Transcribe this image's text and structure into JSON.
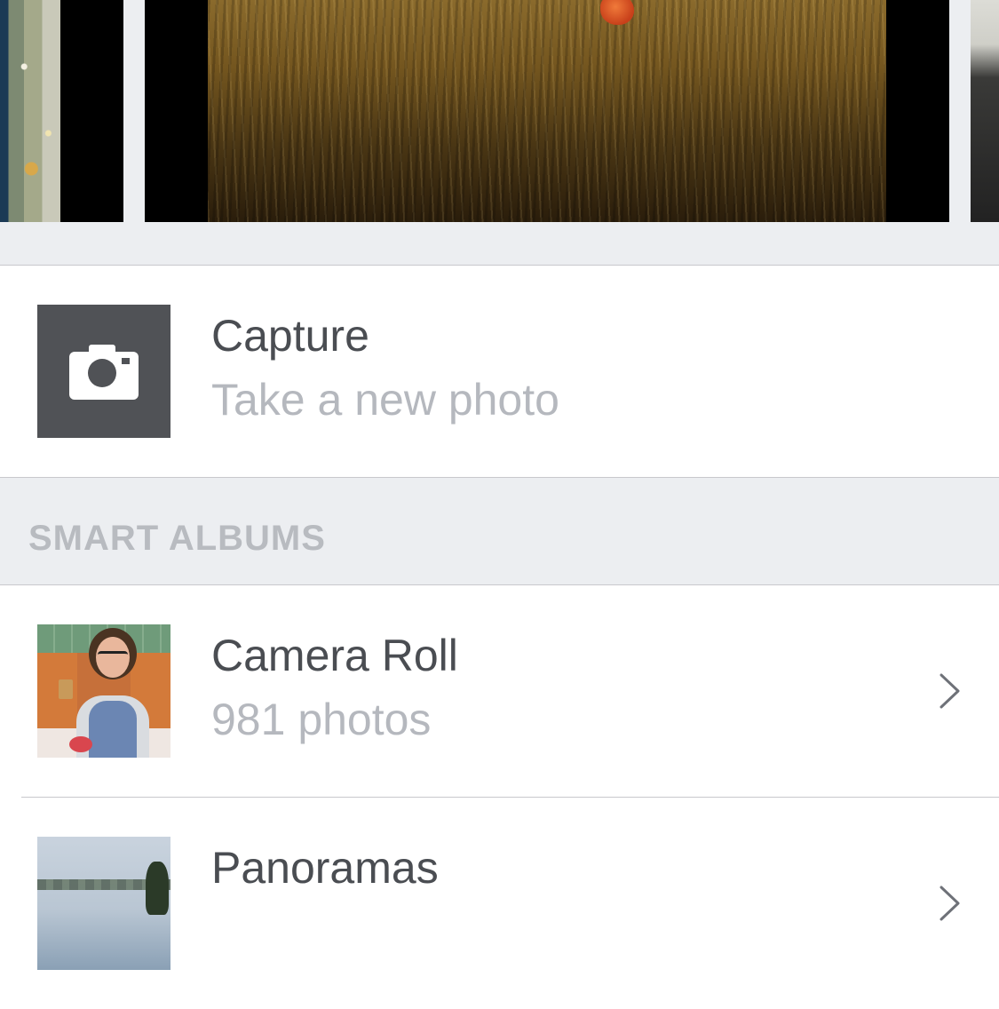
{
  "capture": {
    "title": "Capture",
    "subtitle": "Take a new photo",
    "icon": "camera-icon"
  },
  "smart_albums": {
    "header": "SMART ALBUMS",
    "items": [
      {
        "title": "Camera Roll",
        "subtitle": "981 photos",
        "icon": "chevron-right-icon"
      },
      {
        "title": "Panoramas",
        "icon": "chevron-right-icon"
      }
    ]
  },
  "colors": {
    "background": "#ffffff",
    "section_bg": "#eceef1",
    "title_text": "#4a4d52",
    "subtitle_text": "#b5b8be",
    "camera_tile": "#505256",
    "divider": "#c8c8cc"
  }
}
